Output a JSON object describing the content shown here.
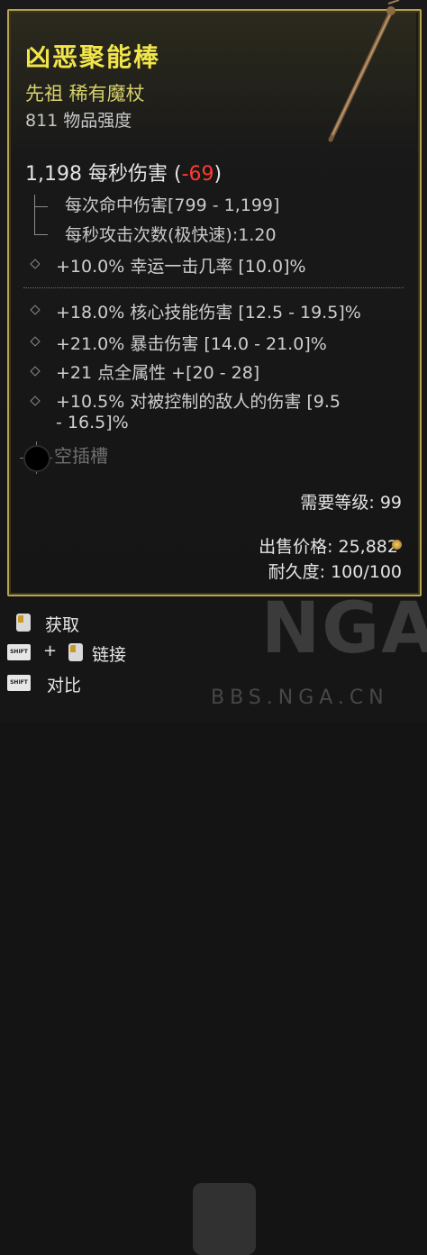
{
  "item": {
    "name": "凶恶聚能棒",
    "subtitle": "先祖 稀有魔杖",
    "item_power": "811 物品强度",
    "dps_value": "1,198 每秒伤害",
    "dps_delta_open": "(",
    "dps_delta": "-69",
    "dps_delta_close": ")",
    "damage_per_hit": "每次命中伤害[799 - 1,199]",
    "attack_speed": "每秒攻击次数(极快速):1.20",
    "implicit_affix": "+10.0% 幸运一击几率 [10.0]%",
    "affixes": [
      "+18.0% 核心技能伤害 [12.5 - 19.5]%",
      "+21.0% 暴击伤害 [14.0 - 21.0]%",
      "+21 点全属性 +[20 - 28]",
      "+10.5% 对被控制的敌人的伤害 [9.5",
      "- 16.5]%"
    ],
    "socket_label": "空插槽",
    "required_level": "需要等级: 99",
    "sell_price": "出售价格: 25,882",
    "durability": "耐久度: 100/100"
  },
  "controls": {
    "acquire": "获取",
    "link": "链接",
    "compare": "对比",
    "shift_key": "SHIFT",
    "plus": "+"
  },
  "watermark": {
    "text": "NGA",
    "url": "BBS.NGA.CN"
  },
  "colors": {
    "title": "#f1e54a",
    "subtitle": "#d7d16d",
    "border": "#b9a34a",
    "negative": "#ff3b30"
  }
}
